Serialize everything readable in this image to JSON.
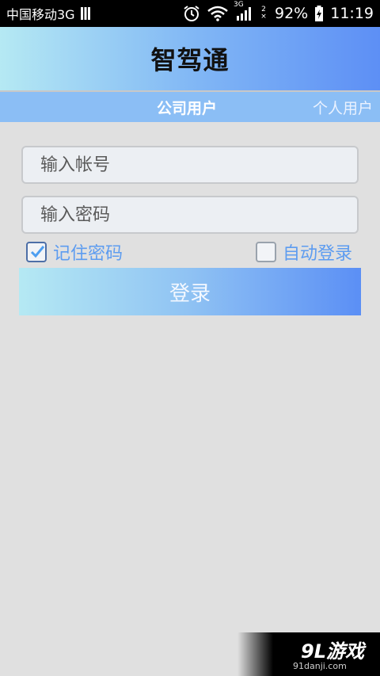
{
  "status_bar": {
    "carrier": "中国移动3G",
    "signal_small_top": "3G",
    "sim_small_top": "2",
    "battery": "92%",
    "time": "11:19"
  },
  "app": {
    "title": "智驾通"
  },
  "tabs": [
    {
      "label": "公司用户",
      "selected": true
    },
    {
      "label": "个人用户",
      "selected": false
    }
  ],
  "form": {
    "account_placeholder": "输入帐号",
    "password_placeholder": "输入密码",
    "remember_label": "记住密码",
    "remember_checked": true,
    "autologin_label": "自动登录",
    "autologin_checked": false,
    "login_label": "登录"
  },
  "watermark": {
    "logo": "9L游戏",
    "url": "91danji.com"
  },
  "colors": {
    "accent": "#5d9cf0",
    "gradient_start": "#b5e9f3",
    "gradient_end": "#5d8ff5"
  }
}
